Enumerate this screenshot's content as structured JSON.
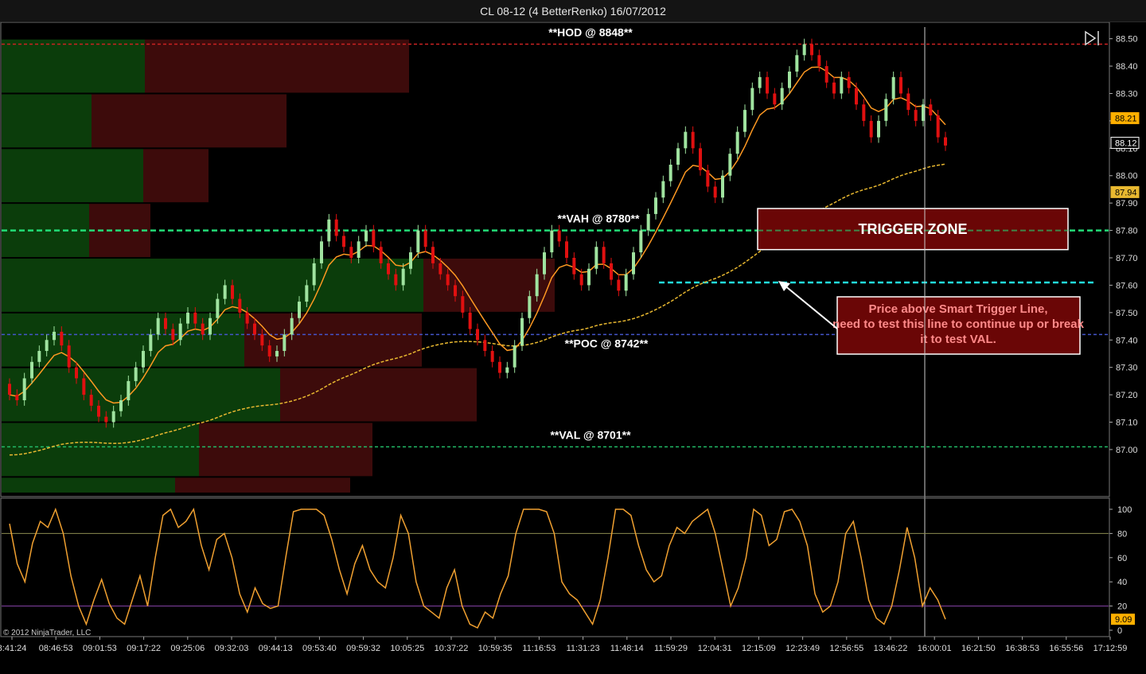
{
  "window": {
    "title": "CL 08-12 (4 BetterRenko)  16/07/2012"
  },
  "colors": {
    "background": "#000000",
    "bull_candle": "#9fe39f",
    "bear_candle": "#e01010",
    "ema_fast": "#ff9922",
    "sma_slow": "#e8b830",
    "hod_line": "#cc2222",
    "vah_line": "#22dd77",
    "poc_line": "#4455cc",
    "val_line": "#22bb66",
    "trigger_line": "#22dddd",
    "vp_buy": "#0b3d0b",
    "vp_sell": "#3d0b0b",
    "stoch": "#f0a030",
    "level_80": "#8c8c50",
    "level_20": "#8844aa",
    "zone_fill": "#6a0606"
  },
  "chart_data": [
    {
      "type": "candlestick",
      "title": "CL 08-12 (4 BetterRenko)  16/07/2012",
      "ylim": [
        86.84,
        88.56
      ],
      "y_ticks": [
        "88.50",
        "88.40",
        "88.30",
        "88.20",
        "88.10",
        "88.00",
        "87.90",
        "87.80",
        "87.70",
        "87.60",
        "87.50",
        "87.40",
        "87.30",
        "87.20",
        "87.10",
        "87.00"
      ],
      "x_tick_labels": [
        "8:41:24",
        "08:46:53",
        "09:01:53",
        "09:17:22",
        "09:25:06",
        "09:32:03",
        "09:44:13",
        "09:53:40",
        "09:59:32",
        "10:05:25",
        "10:37:22",
        "10:59:35",
        "11:16:53",
        "11:31:23",
        "11:48:14",
        "11:59:29",
        "12:04:31",
        "12:15:09",
        "12:23:49",
        "12:56:55",
        "13:46:22",
        "16:00:01",
        "16:21:50",
        "16:38:53",
        "16:55:56",
        "17:12:59"
      ],
      "close_path": [
        87.2,
        87.18,
        87.26,
        87.32,
        87.36,
        87.4,
        87.43,
        87.38,
        87.3,
        87.26,
        87.2,
        87.16,
        87.12,
        87.1,
        87.14,
        87.18,
        87.25,
        87.3,
        87.36,
        87.42,
        87.48,
        87.44,
        87.4,
        87.46,
        87.5,
        87.46,
        87.42,
        87.48,
        87.55,
        87.6,
        87.55,
        87.5,
        87.46,
        87.42,
        87.38,
        87.34,
        87.36,
        87.42,
        87.48,
        87.54,
        87.6,
        87.68,
        87.76,
        87.84,
        87.78,
        87.74,
        87.7,
        87.76,
        87.8,
        87.74,
        87.68,
        87.64,
        87.6,
        87.66,
        87.72,
        87.8,
        87.74,
        87.68,
        87.64,
        87.6,
        87.56,
        87.5,
        87.44,
        87.4,
        87.36,
        87.32,
        87.28,
        87.3,
        87.38,
        87.48,
        87.56,
        87.64,
        87.72,
        87.8,
        87.76,
        87.7,
        87.64,
        87.6,
        87.66,
        87.74,
        87.68,
        87.62,
        87.58,
        87.64,
        87.72,
        87.8,
        87.86,
        87.92,
        87.98,
        88.04,
        88.1,
        88.16,
        88.1,
        88.02,
        87.96,
        87.92,
        88.0,
        88.08,
        88.16,
        88.24,
        88.32,
        88.36,
        88.3,
        88.26,
        88.32,
        88.38,
        88.44,
        88.48,
        88.44,
        88.4,
        88.34,
        88.3,
        88.36,
        88.32,
        88.26,
        88.2,
        88.14,
        88.2,
        88.28,
        88.36,
        88.3,
        88.24,
        88.2,
        88.26,
        88.22,
        88.14,
        88.11
      ],
      "last_price": "88.21",
      "marker_price": "88.12",
      "sma_last": "87.94",
      "volume_profile": [
        {
          "low": 88.3,
          "high": 88.5,
          "buy": 180,
          "sell": 332
        },
        {
          "low": 88.1,
          "high": 88.3,
          "buy": 113,
          "sell": 245
        },
        {
          "low": 87.9,
          "high": 88.1,
          "buy": 178,
          "sell": 82
        },
        {
          "low": 87.7,
          "high": 87.9,
          "buy": 110,
          "sell": 77
        },
        {
          "low": 87.5,
          "high": 87.7,
          "buy": 530,
          "sell": 165
        },
        {
          "low": 87.3,
          "high": 87.5,
          "buy": 305,
          "sell": 223
        },
        {
          "low": 87.1,
          "high": 87.3,
          "buy": 350,
          "sell": 247
        },
        {
          "low": 86.9,
          "high": 87.1,
          "buy": 248,
          "sell": 218
        },
        {
          "low": 86.84,
          "high": 86.9,
          "buy": 218,
          "sell": 220
        }
      ],
      "levels": [
        {
          "name": "HOD",
          "price": 88.48,
          "label": "**HOD @ 8848**"
        },
        {
          "name": "VAH",
          "price": 87.8,
          "label": "**VAH @ 8780**"
        },
        {
          "name": "POC",
          "price": 87.42,
          "label": "**POC @ 8742**"
        },
        {
          "name": "VAL",
          "price": 87.01,
          "label": "**VAL @ 8701**"
        },
        {
          "name": "Smart Trigger",
          "price": 87.61,
          "label": ""
        }
      ],
      "trigger_zone": {
        "label": "TRIGGER ZONE",
        "price_low": 87.73,
        "price_high": 87.88
      },
      "note": "Price above Smart Trigger Line, need to test this line to continue up or break it to test VAL."
    },
    {
      "type": "line",
      "name": "Stochastics",
      "ylim": [
        0,
        100
      ],
      "y_ticks": [
        "100",
        "80",
        "60",
        "40",
        "20",
        "0"
      ],
      "levels": [
        80,
        20
      ],
      "last_value": "9.09",
      "values": [
        88,
        55,
        40,
        72,
        90,
        85,
        100,
        80,
        45,
        20,
        5,
        25,
        42,
        22,
        10,
        5,
        25,
        45,
        20,
        60,
        95,
        100,
        85,
        90,
        100,
        70,
        50,
        75,
        80,
        60,
        30,
        15,
        35,
        22,
        18,
        20,
        60,
        98,
        100,
        100,
        100,
        95,
        75,
        50,
        30,
        55,
        70,
        50,
        40,
        35,
        60,
        95,
        80,
        40,
        20,
        15,
        10,
        35,
        50,
        20,
        5,
        2,
        15,
        10,
        30,
        45,
        80,
        100,
        100,
        100,
        98,
        80,
        40,
        30,
        25,
        15,
        5,
        25,
        60,
        100,
        100,
        95,
        70,
        50,
        40,
        45,
        70,
        85,
        80,
        90,
        95,
        100,
        80,
        50,
        20,
        35,
        60,
        100,
        95,
        70,
        75,
        98,
        100,
        90,
        70,
        30,
        15,
        20,
        40,
        80,
        90,
        60,
        25,
        10,
        5,
        20,
        50,
        85,
        60,
        20,
        35,
        25,
        9.09
      ],
      "watermark": "© 2012 NinjaTrader, LLC"
    }
  ]
}
